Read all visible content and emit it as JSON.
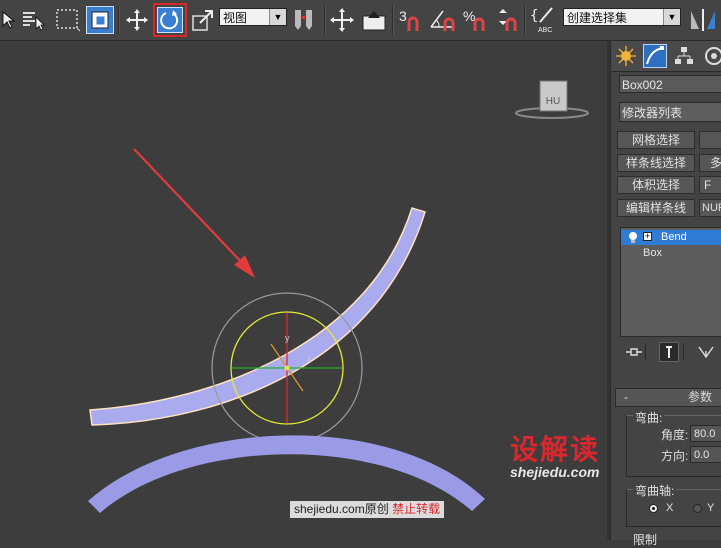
{
  "toolbar": {
    "view_combo": "视图",
    "snap_2d_label": "3",
    "angle_snap_label": "",
    "percent_snap_label": "%",
    "selection_set_combo": "创建选择集"
  },
  "command_panel": {
    "object_name": "Box002",
    "modifier_list": "修改器列表",
    "buttons": [
      {
        "label": "网格选择"
      },
      {
        "label": ""
      },
      {
        "label": "样条线选择"
      },
      {
        "label": "多"
      },
      {
        "label": "体积选择"
      },
      {
        "label": "F"
      },
      {
        "label": "编辑样条线"
      },
      {
        "label": "NUR"
      }
    ],
    "stack": [
      {
        "label": "Bend",
        "selected": true
      },
      {
        "label": "Box",
        "selected": false
      }
    ],
    "params": {
      "rollout_title": "参数",
      "rollout_toggle": "-",
      "bend_group": "弯曲:",
      "angle_label": "角度:",
      "angle_value": "80.0",
      "direction_label": "方向:",
      "direction_value": "0.0",
      "axis_group": "弯曲轴:",
      "axis_x": "X",
      "axis_y": "Y",
      "limit_group": "限制"
    }
  },
  "viewport": {
    "viewcube_label": "HU",
    "gizmo_label_y": "y",
    "gizmo_label_x": "x"
  },
  "watermark": {
    "logo_text": "设解读",
    "logo_url": "shejiedu.com",
    "site_text": "shejiedu.com原创",
    "warning_text": "禁止转载"
  },
  "colors": {
    "highlight_box": "#d9272e",
    "object_fill": "#aaaaee",
    "selected_row": "#2f7bd6",
    "arrow": "#e33b3b"
  }
}
